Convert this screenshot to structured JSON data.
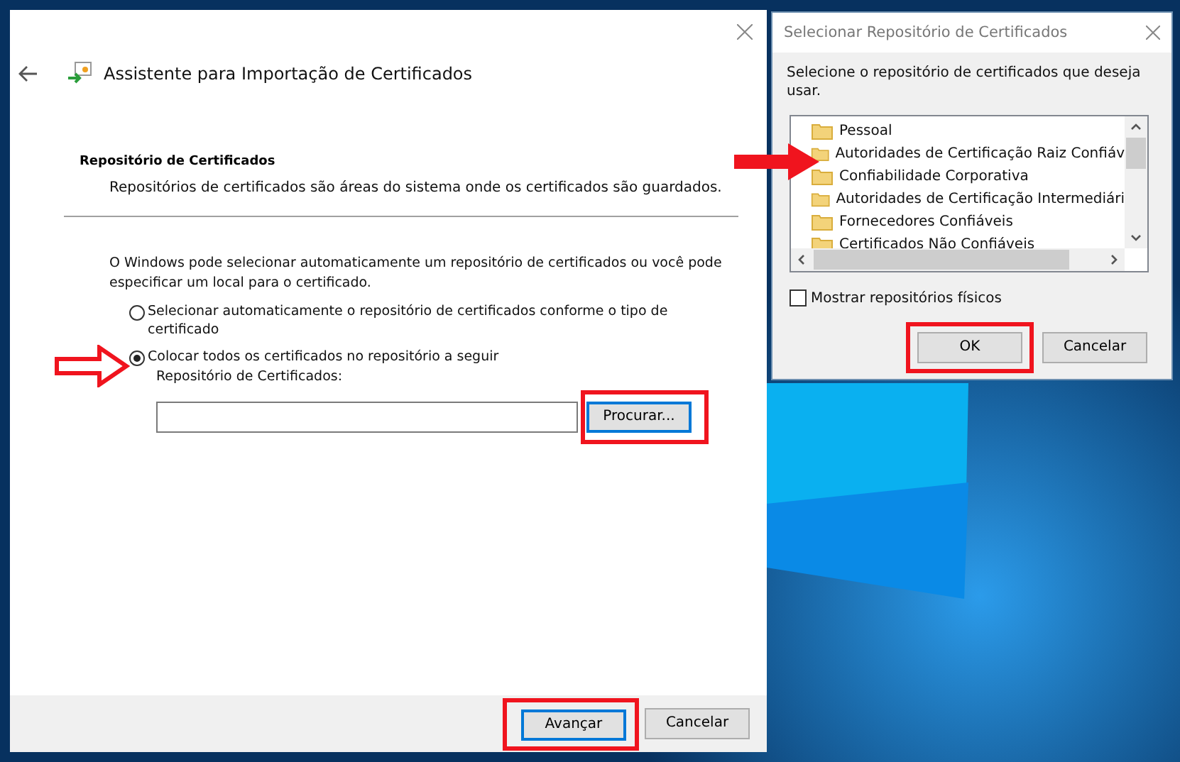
{
  "wizard": {
    "title": "Assistente para Importação de Certificados",
    "heading": "Repositório de Certificados",
    "description": "Repositórios de certificados são áreas do sistema onde os certificados são guardados.",
    "intro": "O Windows pode selecionar automaticamente um repositório de certificados ou você pode especificar um local para o certificado.",
    "options": [
      {
        "label": "Selecionar automaticamente o repositório de certificados conforme o tipo de certificado",
        "selected": false
      },
      {
        "label": "Colocar todos os certificados no repositório a seguir",
        "selected": true
      }
    ],
    "store_label": "Repositório de Certificados:",
    "browse_button": {
      "label": "Procurar...",
      "focused": true
    },
    "buttons": [
      {
        "label": "Avançar",
        "focused": true
      },
      {
        "label": "Cancelar",
        "focused": false
      }
    ]
  },
  "dialog": {
    "title": "Selecionar Repositório de Certificados",
    "prompt": "Selecione o repositório de certificados que deseja usar.",
    "stores": [
      {
        "label": "Pessoal",
        "selected": false
      },
      {
        "label": "Autoridades de Certificação Raiz Confiáv",
        "selected": false
      },
      {
        "label": "Confiabilidade Corporativa",
        "selected": false
      },
      {
        "label": "Autoridades de Certificação Intermediári",
        "selected": false
      },
      {
        "label": "Fornecedores Confiáveis",
        "selected": false
      },
      {
        "label": "Certificados Não Confiáveis",
        "selected": false
      }
    ],
    "show_physical": {
      "label": "Mostrar repositórios físicos",
      "checked": false
    },
    "buttons": [
      {
        "label": "OK",
        "focused": false
      },
      {
        "label": "Cancelar",
        "focused": false
      }
    ]
  }
}
